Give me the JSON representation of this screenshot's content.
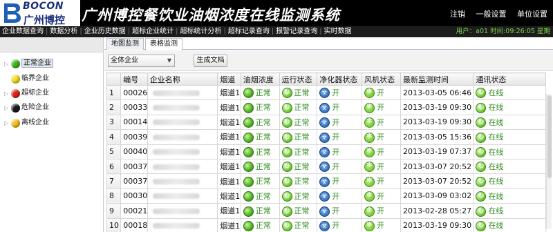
{
  "header": {
    "logo_en": "BOCON",
    "logo_cn": "广州博控",
    "title": "广州博控餐饮业油烟浓度在线监测系统",
    "links": [
      "注销",
      "一般设置",
      "单位设置"
    ]
  },
  "nav": {
    "items": [
      "企业数据查询",
      "数据分析",
      "企业历史数据",
      "超标企业统计",
      "超标统计分析",
      "超标记录查询",
      "报警记录查询",
      "实时数据"
    ],
    "user_info": "用户：a01 时间:09:26:05 星期"
  },
  "sidebar": {
    "items": [
      {
        "label": "正常企业",
        "color": "#3fb81c",
        "icon": "green-status-icon"
      },
      {
        "label": "临界企业",
        "color": "#f2e21a",
        "icon": "yellow-status-icon"
      },
      {
        "label": "超标企业",
        "color": "#e0241c",
        "icon": "red-status-icon"
      },
      {
        "label": "危险企业",
        "color": "#1a1a1a",
        "icon": "black-status-icon"
      },
      {
        "label": "离线企业",
        "color": "#f4c21a",
        "icon": "offline-status-icon"
      }
    ]
  },
  "tabs": [
    "地图监测",
    "表格监测"
  ],
  "toolbar": {
    "filter_value": "全体企业",
    "generate_doc": "生成文档"
  },
  "table": {
    "headers": [
      "",
      "编号",
      "企业名称",
      "烟道",
      "油烟浓度",
      "运行状态",
      "净化器状态",
      "风机状态",
      "最新监测时间",
      "通讯状态"
    ],
    "rows": [
      {
        "n": "1",
        "id": "00026",
        "flue": "烟道1",
        "conc": "正常",
        "run": "正常",
        "puri": "开",
        "fan": "开",
        "time": "2013-03-05 06:46",
        "comm": "在线"
      },
      {
        "n": "2",
        "id": "00033",
        "flue": "烟道1",
        "conc": "正常",
        "run": "正常",
        "puri": "开",
        "fan": "开",
        "time": "2013-03-19 09:30",
        "comm": "在线"
      },
      {
        "n": "3",
        "id": "00014",
        "flue": "烟道1",
        "conc": "正常",
        "run": "正常",
        "puri": "开",
        "fan": "开",
        "time": "2013-03-19 09:30",
        "comm": "在线"
      },
      {
        "n": "4",
        "id": "00039",
        "flue": "烟道1",
        "conc": "正常",
        "run": "正常",
        "puri": "开",
        "fan": "开",
        "time": "2013-03-05 15:36",
        "comm": "在线"
      },
      {
        "n": "5",
        "id": "00040",
        "flue": "烟道1",
        "conc": "正常",
        "run": "正常",
        "puri": "开",
        "fan": "开",
        "time": "2013-03-19 07:37",
        "comm": "在线"
      },
      {
        "n": "6",
        "id": "00037",
        "flue": "烟道1",
        "conc": "正常",
        "run": "正常",
        "puri": "开",
        "fan": "开",
        "time": "2013-03-07 20:52",
        "comm": "在线"
      },
      {
        "n": "7",
        "id": "00037",
        "flue": "烟道1",
        "conc": "正常",
        "run": "正常",
        "puri": "开",
        "fan": "开",
        "time": "2013-03-07 20:52",
        "comm": "在线"
      },
      {
        "n": "8",
        "id": "00030",
        "flue": "烟道1",
        "conc": "正常",
        "run": "正常",
        "puri": "开",
        "fan": "开",
        "time": "2013-03-09 03:02",
        "comm": "在线"
      },
      {
        "n": "9",
        "id": "00021",
        "flue": "烟道1",
        "conc": "正常",
        "run": "正常",
        "puri": "开",
        "fan": "开",
        "time": "2013-02-28 05:27",
        "comm": "在线"
      },
      {
        "n": "10",
        "id": "00018",
        "flue": "烟道1",
        "conc": "正常",
        "run": "正常",
        "puri": "开",
        "fan": "开",
        "time": "2013-03-19 09:30",
        "comm": "在线"
      }
    ]
  }
}
